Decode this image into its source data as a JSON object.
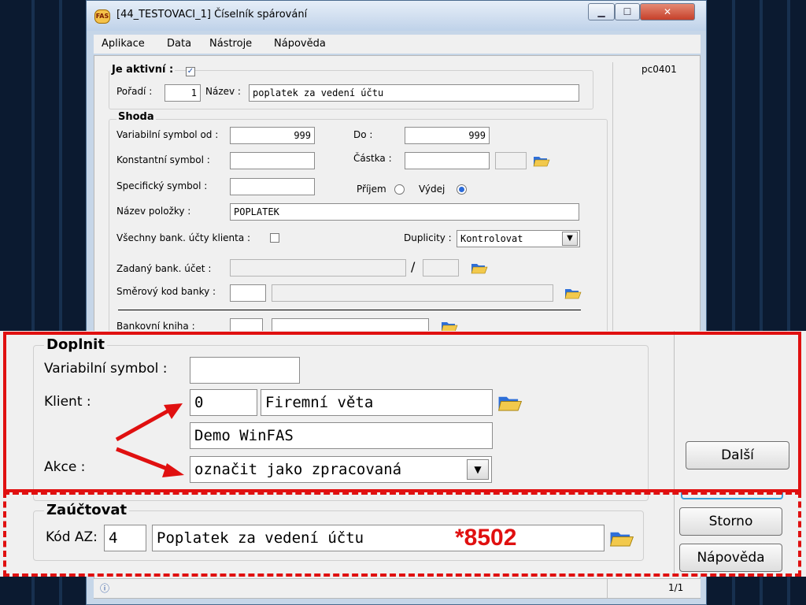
{
  "window": {
    "title": "[44_TESTOVACI_1] Číselník spárování",
    "app_icon": "FAS"
  },
  "menu": [
    {
      "label": "Aplikace"
    },
    {
      "label": "Data"
    },
    {
      "label": "Nástroje"
    },
    {
      "label": "Nápověda"
    }
  ],
  "pc_code": "pc0401",
  "top": {
    "active_label": "Je aktivní :",
    "active_checked": true,
    "order_label": "Pořadí :",
    "order_value": "1",
    "name_label": "Název :",
    "name_value": "poplatek za vedení účtu"
  },
  "shoda": {
    "title": "Shoda",
    "var_from_label": "Variabilní symbol od :",
    "var_from_value": "999",
    "to_label": "Do :",
    "to_value": "999",
    "konst_label": "Konstantní symbol :",
    "castka_label": "Částka :",
    "spec_label": "Specifický symbol :",
    "prijem_label": "Příjem",
    "vydej_label": "Výdej",
    "vydej_selected": true,
    "polozka_label": "Název položky :",
    "polozka_value": "POPLATEK",
    "all_accounts_label": "Všechny bank. účty klienta :",
    "duplicity_label": "Duplicity :",
    "duplicity_value": "Kontrolovat",
    "bank_account_label": "Zadaný bank. účet :",
    "slash": "/",
    "bank_code_label": "Směrový kod banky :",
    "bank_book_label": "Bankovní kniha :"
  },
  "doplnit": {
    "title": "Doplnit",
    "var_label": "Variabilní symbol :",
    "var_value": "",
    "client_label": "Klient :",
    "client_code": "0",
    "client_name": "Firemní věta",
    "client_name2": "Demo WinFAS",
    "action_label": "Akce :",
    "action_value": "označit jako zpracovaná"
  },
  "zauctovat": {
    "title": "Zaúčtovat",
    "kod_label": "Kód AZ:",
    "kod_value": "4",
    "kod_name": "Poplatek za vedení účtu",
    "annotation": "*8502"
  },
  "buttons": {
    "next": "Další",
    "cancel": "Storno",
    "help": "Nápověda"
  },
  "status": {
    "page": "1/1"
  },
  "colors": {
    "annotation_red": "#e01010",
    "accent_blue": "#2a6ad8"
  }
}
